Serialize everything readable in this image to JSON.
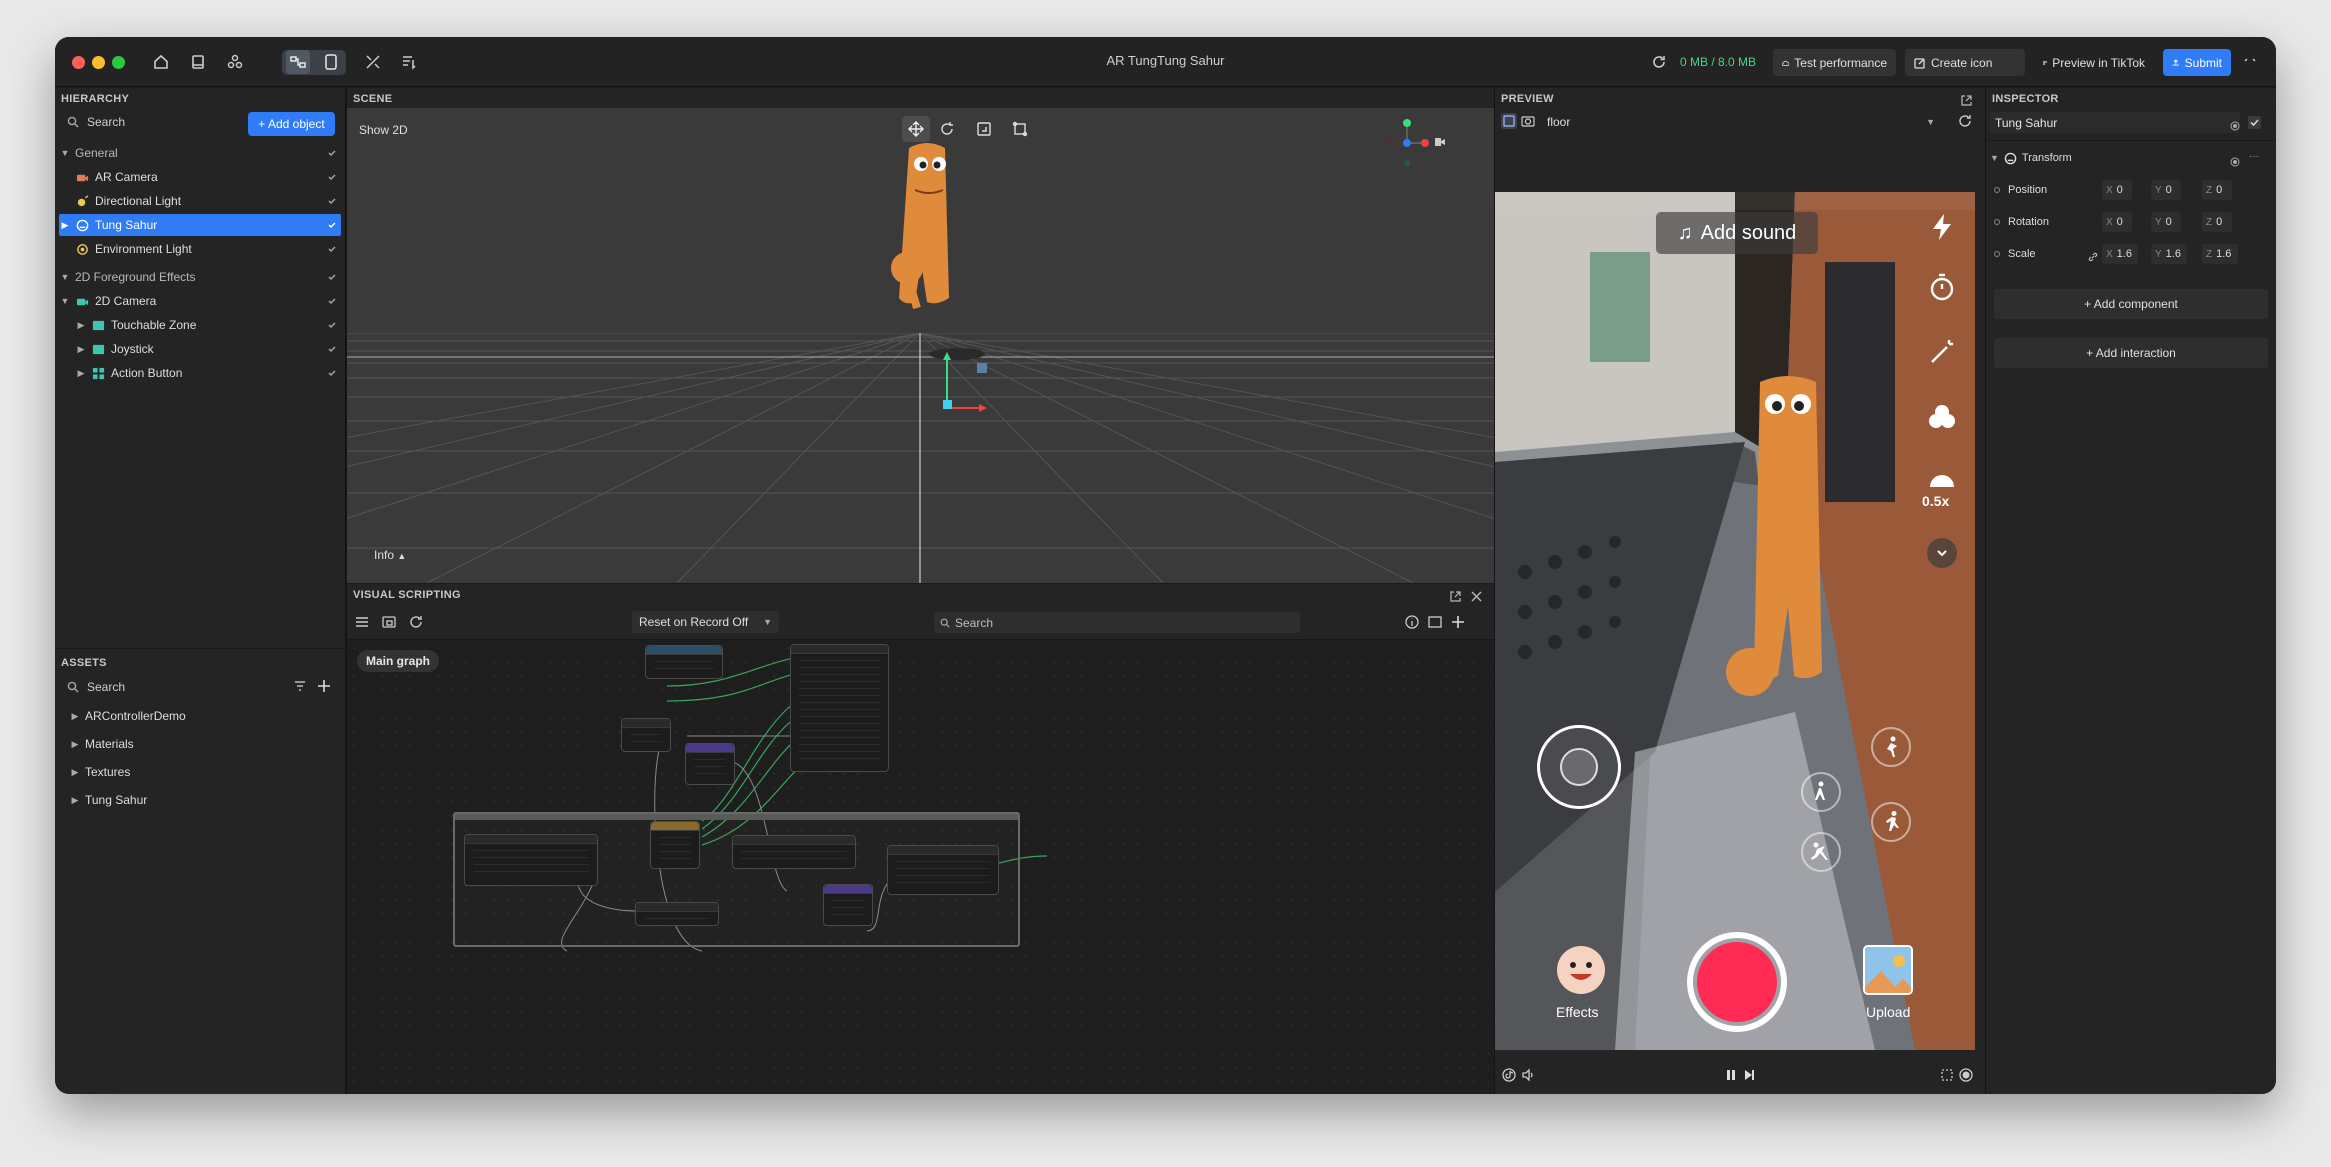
{
  "titlebar": {
    "app_title": "AR TungTung Sahur",
    "memory": "0 MB / 8.0 MB",
    "test_performance": "Test performance",
    "create_icon": "Create icon",
    "preview_tiktok": "Preview in TikTok",
    "submit": "Submit"
  },
  "hierarchy": {
    "title": "HIERARCHY",
    "search_placeholder": "Search",
    "add_object": "+ Add object",
    "items": [
      "General",
      "AR Camera",
      "Directional Light",
      "Tung Sahur",
      "Environment Light",
      "2D Foreground Effects",
      "2D Camera",
      "Touchable Zone",
      "Joystick",
      "Action Button"
    ]
  },
  "assets": {
    "title": "ASSETS",
    "search_placeholder": "Search",
    "folders": [
      "ARControllerDemo",
      "Materials",
      "Textures",
      "Tung Sahur"
    ]
  },
  "scene": {
    "title": "SCENE",
    "show2d": "Show 2D",
    "info": "Info"
  },
  "visual_scripting": {
    "title": "VISUAL SCRIPTING",
    "dropdown": "Reset on Record Off",
    "search_placeholder": "Search",
    "main_graph": "Main graph"
  },
  "preview": {
    "title": "PREVIEW",
    "dropdown": "floor",
    "add_sound": "Add sound",
    "speed": "0.5x",
    "effects": "Effects",
    "upload": "Upload"
  },
  "inspector": {
    "title": "INSPECTOR",
    "object_name": "Tung Sahur",
    "component": "Transform",
    "position": {
      "label": "Position",
      "x": "0",
      "y": "0",
      "z": "0"
    },
    "rotation": {
      "label": "Rotation",
      "x": "0",
      "y": "0",
      "z": "0"
    },
    "scale": {
      "label": "Scale",
      "x": "1.6",
      "y": "1.6",
      "z": "1.6"
    },
    "add_component": "+ Add component",
    "add_interaction": "+ Add interaction"
  },
  "colors": {
    "accent": "#2f7cf6",
    "memory_green": "#3ddc84",
    "record_red": "#fe2c55"
  }
}
